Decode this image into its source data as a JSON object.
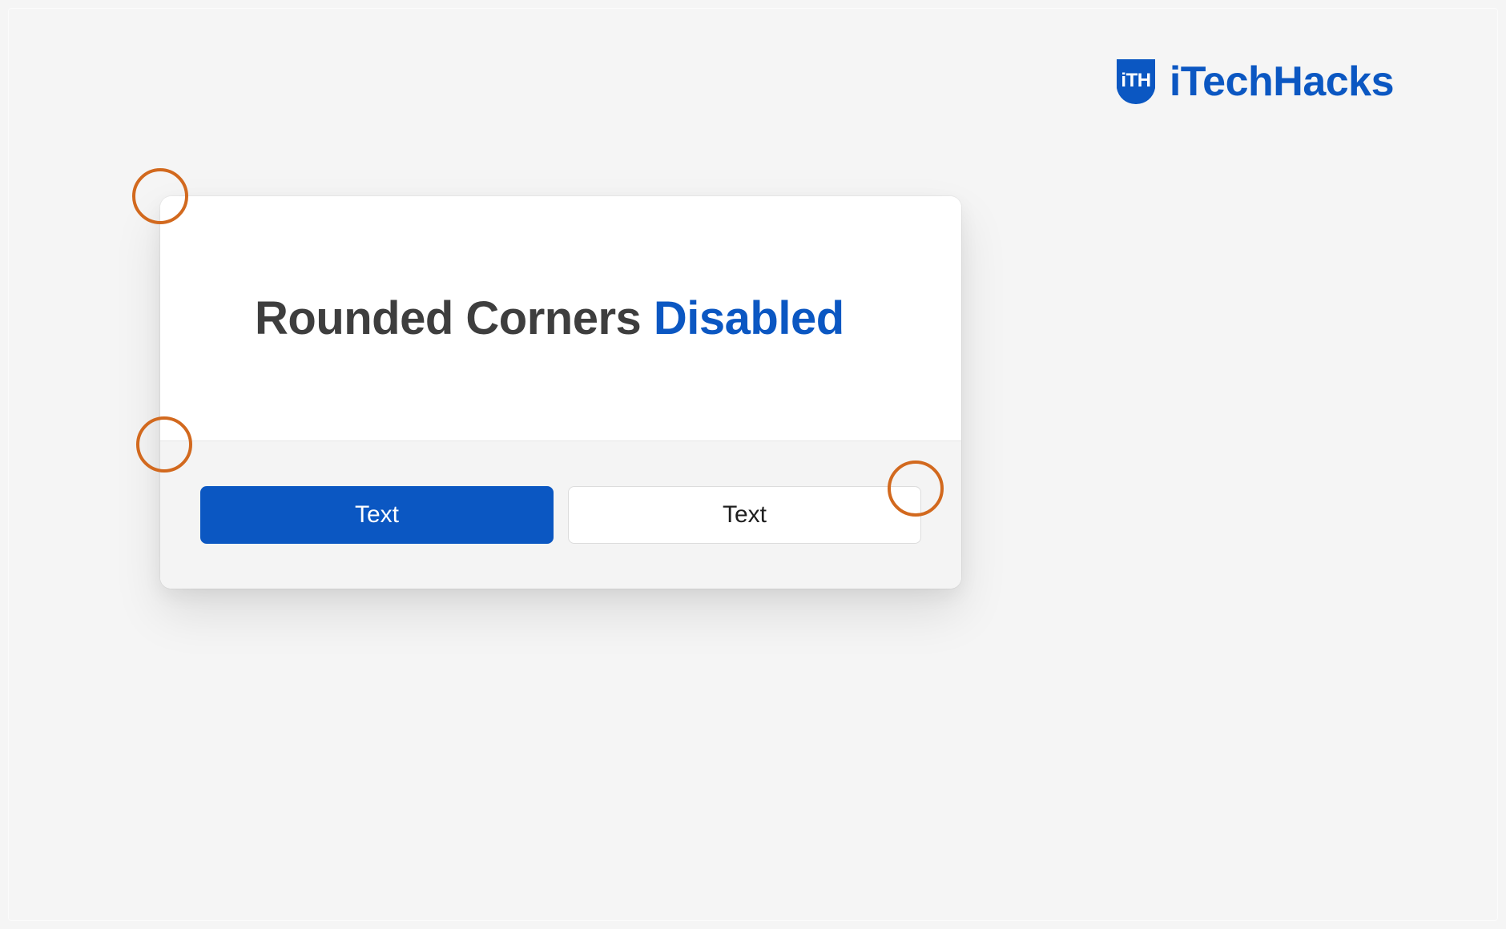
{
  "brand": {
    "name": "iTechHacks",
    "logo_label": "itechhacks-logo-icon",
    "color": "#0b57c2"
  },
  "dialog": {
    "title_main": "Rounded Corners ",
    "title_accent": "Disabled",
    "buttons": {
      "primary_label": "Text",
      "secondary_label": "Text"
    }
  },
  "colors": {
    "brand_blue": "#0b57c2",
    "annotation_orange": "#d2691e",
    "heading_gray": "#3e3e3e",
    "page_bg": "#f5f5f5",
    "footer_bg": "#f4f4f4"
  },
  "annotations": {
    "count": 3,
    "purpose": "highlight-corners"
  }
}
